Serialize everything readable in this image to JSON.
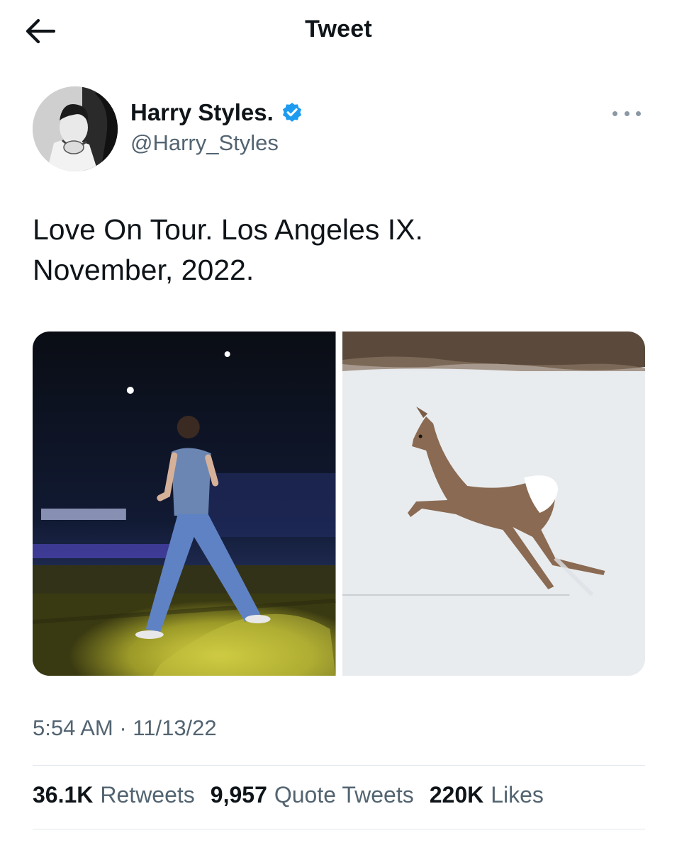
{
  "topbar": {
    "back_icon": "arrow-left-icon",
    "title": "Tweet"
  },
  "author": {
    "display_name": "Harry Styles.",
    "handle": "@Harry_Styles",
    "verified_icon": "verified-badge-icon",
    "verified_color": "#1d9bf0",
    "more_icon": "more-dots-icon"
  },
  "tweet": {
    "text_lines": [
      "Love On Tour. Los Angeles IX.",
      "November, 2022."
    ]
  },
  "media": {
    "photos": [
      {
        "subject": "performer-on-stage-photo"
      },
      {
        "subject": "leaping-deer-in-snow-photo"
      }
    ]
  },
  "meta": {
    "timestamp": "5:54 AM · 11/13/22"
  },
  "stats": {
    "retweets": {
      "count": "36.1K",
      "label": "Retweets"
    },
    "quote_tweets": {
      "count": "9,957",
      "label": "Quote Tweets"
    },
    "likes": {
      "count": "220K",
      "label": "Likes"
    }
  },
  "colors": {
    "text_primary": "#0f1419",
    "text_secondary": "#536471",
    "divider": "#e1e8ed"
  }
}
